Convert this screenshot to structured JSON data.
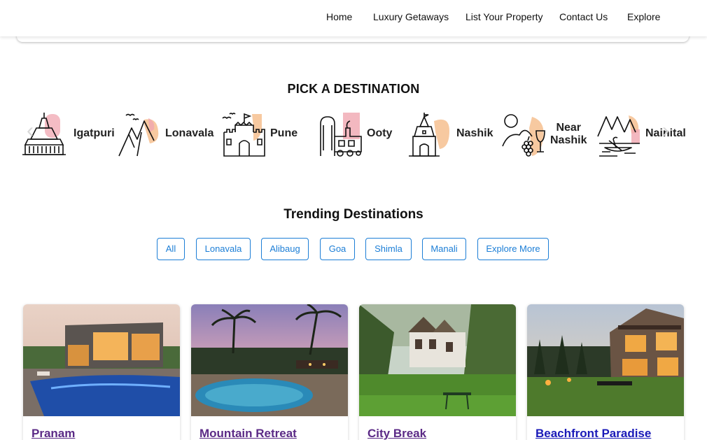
{
  "nav": {
    "items": [
      {
        "label": "Home"
      },
      {
        "label": "Luxury Getaways"
      },
      {
        "label": "List Your Property"
      },
      {
        "label": "Contact Us"
      },
      {
        "label": "Explore"
      }
    ]
  },
  "pick_destination": {
    "title": "PICK A DESTINATION",
    "items": [
      {
        "label": "Igatpuri",
        "icon": "pagoda-icon"
      },
      {
        "label": "Lonavala",
        "icon": "mountains-icon"
      },
      {
        "label": "Pune",
        "icon": "fort-icon"
      },
      {
        "label": "Ooty",
        "icon": "toy-train-icon"
      },
      {
        "label": "Nashik",
        "icon": "temple-icon"
      },
      {
        "label_line1": "Near",
        "label_line2": "Nashik",
        "icon": "vineyard-icon"
      },
      {
        "label": "Nainital",
        "icon": "lake-boat-icon"
      }
    ],
    "prev_arrow": "‹",
    "next_arrow": "›"
  },
  "trending": {
    "title": "Trending Destinations",
    "filters": [
      "All",
      "Lonavala",
      "Alibaug",
      "Goa",
      "Shimla",
      "Manali",
      "Explore More"
    ]
  },
  "properties": [
    {
      "name": "Pranam",
      "link_state": "visited"
    },
    {
      "name": "Mountain Retreat",
      "link_state": "visited"
    },
    {
      "name": "City Break",
      "link_state": "visited"
    },
    {
      "name": "Beachfront Paradise",
      "link_state": "unvisited"
    }
  ],
  "colors": {
    "accent_blue": "#1c7ed6",
    "icon_peach": "#f7c9a0",
    "icon_pink": "#f0a6b0",
    "visited_link": "#5b2a86",
    "link": "#1a1ab8"
  }
}
